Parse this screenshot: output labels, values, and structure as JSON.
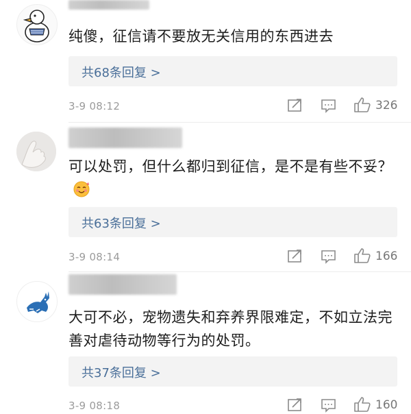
{
  "comments": [
    {
      "text": "纯傻，征信请不要放无关信用的东西进去",
      "replies": "共68条回复 >",
      "time": "3-9 08:12",
      "likes": "326"
    },
    {
      "text": "可以处罚，但什么都归到征信，是不是有些不妥？",
      "replies": "共63条回复 >",
      "time": "3-9 08:14",
      "likes": "166"
    },
    {
      "text": "大可不必，宠物遗失和弃养界限难定，不如立法完善对虐待动物等行为的处罚。",
      "replies": "共37条回复 >",
      "time": "3-9 08:18",
      "likes": "160"
    }
  ],
  "colors": {
    "link": "#4a6f99",
    "meta": "#9b9b9b",
    "reply_bg": "#f3f3f3"
  },
  "icons": [
    "repost-icon",
    "comment-icon",
    "thumbs-up-icon",
    "blush-emoji-icon"
  ]
}
